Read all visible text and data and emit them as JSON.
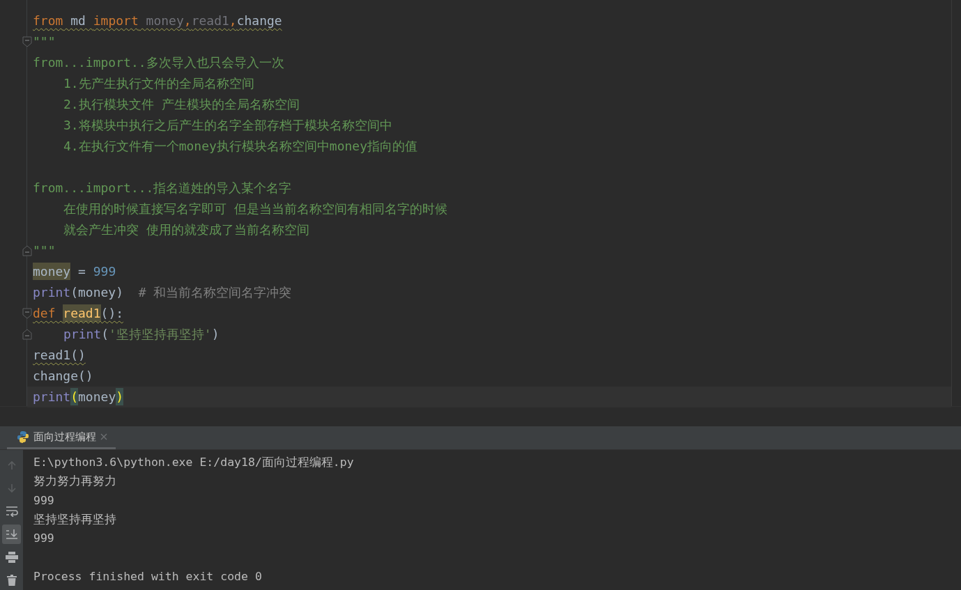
{
  "editor": {
    "lines": [
      {
        "kind": "code",
        "warning": true,
        "tokens": [
          {
            "kind": "keyword",
            "text": "from"
          },
          {
            "kind": "name",
            "text": " md "
          },
          {
            "kind": "keyword",
            "text": "import"
          },
          {
            "kind": "unused",
            "text": " money"
          },
          {
            "kind": "comma",
            "text": ","
          },
          {
            "kind": "unused",
            "text": "read1"
          },
          {
            "kind": "comma",
            "text": ","
          },
          {
            "kind": "name",
            "text": "change"
          }
        ]
      },
      {
        "kind": "code",
        "fold_start": true,
        "tokens": [
          {
            "kind": "doc",
            "text": "\"\"\""
          }
        ]
      },
      {
        "kind": "code",
        "tokens": [
          {
            "kind": "doc",
            "text": "from...import..多次导入也只会导入一次"
          }
        ]
      },
      {
        "kind": "code",
        "indented": true,
        "tokens": [
          {
            "kind": "doc",
            "text": "1.先产生执行文件的全局名称空间"
          }
        ]
      },
      {
        "kind": "code",
        "indented": true,
        "tokens": [
          {
            "kind": "doc",
            "text": "2.执行模块文件 产生模块的全局名称空间"
          }
        ]
      },
      {
        "kind": "code",
        "indented": true,
        "tokens": [
          {
            "kind": "doc",
            "text": "3.将模块中执行之后产生的名字全部存档于模块名称空间中"
          }
        ]
      },
      {
        "kind": "code",
        "indented": true,
        "tokens": [
          {
            "kind": "doc",
            "text": "4.在执行文件有一个money执行模块名称空间中money指向的值"
          }
        ]
      },
      {
        "kind": "blank"
      },
      {
        "kind": "code",
        "tokens": [
          {
            "kind": "doc",
            "text": "from...import...指名道姓的导入某个名字"
          }
        ]
      },
      {
        "kind": "code",
        "indented": true,
        "tokens": [
          {
            "kind": "doc",
            "text": "在使用的时候直接写名字即可 但是当当前名称空间有相同名字的时候"
          }
        ]
      },
      {
        "kind": "code",
        "indented": true,
        "tokens": [
          {
            "kind": "doc",
            "text": "就会产生冲突 使用的就变成了当前名称空间"
          }
        ]
      },
      {
        "kind": "code",
        "fold_end": true,
        "tokens": [
          {
            "kind": "doc",
            "text": "\"\"\""
          }
        ]
      },
      {
        "kind": "code",
        "tokens": [
          {
            "kind": "name",
            "text": "money",
            "highlight": true
          },
          {
            "kind": "name",
            "text": " = "
          },
          {
            "kind": "number",
            "text": "999"
          }
        ]
      },
      {
        "kind": "code",
        "tokens": [
          {
            "kind": "builtin",
            "text": "print"
          },
          {
            "kind": "name",
            "text": "(money)"
          },
          {
            "kind": "comment",
            "text": "  # 和当前名称空间名字冲突"
          }
        ]
      },
      {
        "kind": "code",
        "fold_start": true,
        "warning": true,
        "tokens": [
          {
            "kind": "keyword",
            "text": "def "
          },
          {
            "kind": "func",
            "text": "read1",
            "highlight": true
          },
          {
            "kind": "name",
            "text": "():"
          }
        ]
      },
      {
        "kind": "code",
        "fold_end": true,
        "indented": true,
        "tokens": [
          {
            "kind": "builtin",
            "text": "print"
          },
          {
            "kind": "name",
            "text": "("
          },
          {
            "kind": "string",
            "text": "'坚持坚持再坚持'"
          },
          {
            "kind": "name",
            "text": ")"
          }
        ]
      },
      {
        "kind": "code",
        "warning": true,
        "tokens": [
          {
            "kind": "name",
            "text": "read1()"
          }
        ]
      },
      {
        "kind": "code",
        "tokens": [
          {
            "kind": "name",
            "text": "change()"
          }
        ]
      },
      {
        "kind": "code",
        "current": true,
        "tokens": [
          {
            "kind": "builtin",
            "text": "print"
          },
          {
            "kind": "brace",
            "text": "(",
            "highlight": true
          },
          {
            "kind": "name",
            "text": "money"
          },
          {
            "kind": "brace",
            "text": ")",
            "highlight": true
          }
        ]
      }
    ]
  },
  "run_panel": {
    "tabs": [
      {
        "label": "面向过程编程",
        "selected": true
      }
    ],
    "toolbar": [
      {
        "kind": "up",
        "disabled": true,
        "selected": false
      },
      {
        "kind": "down",
        "disabled": true,
        "selected": false
      },
      {
        "kind": "wrap",
        "disabled": false,
        "selected": false
      },
      {
        "kind": "scroll",
        "disabled": false,
        "selected": true
      },
      {
        "kind": "print",
        "disabled": false,
        "selected": false
      },
      {
        "kind": "trash",
        "disabled": false,
        "selected": false
      }
    ],
    "output": [
      {
        "kind": "text",
        "text": "E:\\python3.6\\python.exe E:/day18/面向过程编程.py"
      },
      {
        "kind": "text",
        "text": "努力努力再努力"
      },
      {
        "kind": "text",
        "text": "999"
      },
      {
        "kind": "text",
        "text": "坚持坚持再坚持"
      },
      {
        "kind": "text",
        "text": "999"
      },
      {
        "kind": "blank"
      },
      {
        "kind": "text",
        "text": "Process finished with exit code 0"
      }
    ]
  }
}
